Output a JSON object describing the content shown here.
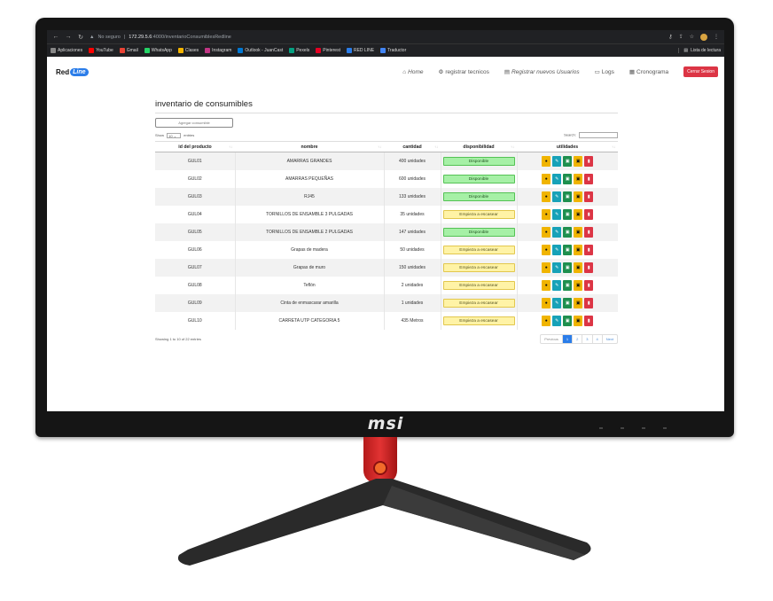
{
  "browser": {
    "security_label": "No seguro",
    "url_host": "172.29.5.6",
    "url_path": ":4000/inventarioConsumiblesRedline",
    "bookmarks": [
      {
        "label": "Aplicaciones",
        "color": "#888888"
      },
      {
        "label": "YouTube",
        "color": "#ff0000"
      },
      {
        "label": "Gmail",
        "color": "#ea4335"
      },
      {
        "label": "WhatsApp",
        "color": "#25d366"
      },
      {
        "label": "Clases",
        "color": "#f4b400"
      },
      {
        "label": "Instagram",
        "color": "#c13584"
      },
      {
        "label": "Outlook - JuanCast",
        "color": "#0078d4"
      },
      {
        "label": "Pexels",
        "color": "#05a081"
      },
      {
        "label": "Pinterest",
        "color": "#e60023"
      },
      {
        "label": "RED LINE",
        "color": "#2b7de9"
      },
      {
        "label": "Traductor",
        "color": "#4285f4"
      }
    ],
    "reading_list": "Lista de lectura"
  },
  "navbar": {
    "logo_text": "Red",
    "logo_pill": "Line",
    "home": "Home",
    "registrar_tecnicos": "registrar tecnicos",
    "registrar_usuarios": "Registrar nuevos Usuarios",
    "logs": "Logs",
    "cronograma": "Cronograma",
    "logout": "Cerrar Sesion"
  },
  "page": {
    "title": "inventario de consumibles",
    "add_button": "Agregar consumible",
    "show_label": "Show",
    "entries_value": "10",
    "entries_label": "entries",
    "search_label": "Search:",
    "info": "Showing 1 to 10 of 22 entries"
  },
  "table": {
    "headers": [
      "id del producto",
      "nombre",
      "cantidad",
      "disponibilidad",
      "utilidades"
    ],
    "rows": [
      {
        "id": "GUL01",
        "nombre": "AMARRAS GRANDES",
        "cantidad": "400 unidades",
        "disponibilidad": "Disponible",
        "status": "green"
      },
      {
        "id": "GUL02",
        "nombre": "AMARRAS PEQUEÑAS",
        "cantidad": "600 unidades",
        "disponibilidad": "Disponible",
        "status": "green"
      },
      {
        "id": "GUL03",
        "nombre": "RJ45",
        "cantidad": "133 unidades",
        "disponibilidad": "Disponible",
        "status": "green"
      },
      {
        "id": "GUL04",
        "nombre": "TORNILLOS DE ENSAMBLE 3 PULGADAS",
        "cantidad": "35 unidades",
        "disponibilidad": "Empieza a escasear",
        "status": "yellow"
      },
      {
        "id": "GUL05",
        "nombre": "TORNILLOS DE ENSAMBLE 2 PULGADAS",
        "cantidad": "147 unidades",
        "disponibilidad": "Disponible",
        "status": "green"
      },
      {
        "id": "GUL06",
        "nombre": "Grapas de madera",
        "cantidad": "50 unidades",
        "disponibilidad": "Empieza a escasear",
        "status": "yellow"
      },
      {
        "id": "GUL07",
        "nombre": "Grapas de muro",
        "cantidad": "150 unidades",
        "disponibilidad": "Empieza a escasear",
        "status": "yellow"
      },
      {
        "id": "GUL08",
        "nombre": "Teflón",
        "cantidad": "2 unidades",
        "disponibilidad": "Empieza a escasear",
        "status": "yellow"
      },
      {
        "id": "GUL09",
        "nombre": "Cinta de enmascarar amarilla",
        "cantidad": "1 unidades",
        "disponibilidad": "Empieza a escasear",
        "status": "yellow"
      },
      {
        "id": "GUL10",
        "nombre": "CARRETA UTP CATEGORIA 5",
        "cantidad": "435 Metros",
        "disponibilidad": "Empieza a escasear",
        "status": "yellow"
      }
    ]
  },
  "pagination": {
    "previous": "Previous",
    "pages": [
      "1",
      "2",
      "3",
      "4"
    ],
    "next": "Next"
  },
  "monitor": {
    "brand": "msi"
  }
}
